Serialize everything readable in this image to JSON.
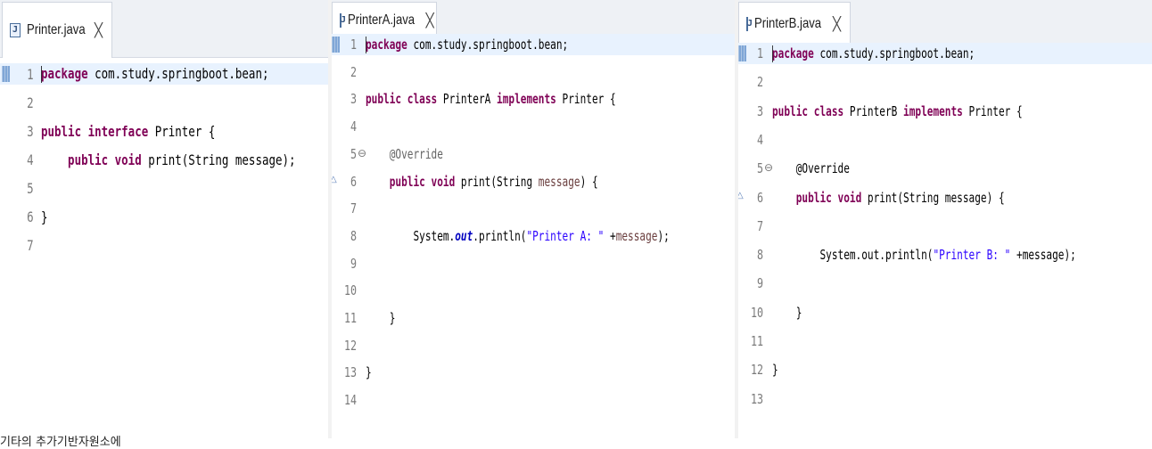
{
  "panels": [
    {
      "id": "printer",
      "tab": {
        "file_icon": "java-file-icon",
        "name": "Printer.java",
        "close": "╳"
      },
      "lines": [
        {
          "n": "1",
          "tokens": [
            {
              "t": "package",
              "c": "kw"
            },
            {
              "t": " com.study.springboot.bean;",
              "c": ""
            }
          ],
          "current": true
        },
        {
          "n": "2",
          "tokens": []
        },
        {
          "n": "3",
          "tokens": [
            {
              "t": "public",
              "c": "kw"
            },
            {
              "t": " ",
              "c": ""
            },
            {
              "t": "interface",
              "c": "kw"
            },
            {
              "t": " Printer {",
              "c": ""
            }
          ]
        },
        {
          "n": "4",
          "tokens": [
            {
              "t": "    ",
              "c": ""
            },
            {
              "t": "public",
              "c": "kw"
            },
            {
              "t": " ",
              "c": ""
            },
            {
              "t": "void",
              "c": "kw"
            },
            {
              "t": " print(String message);",
              "c": ""
            }
          ]
        },
        {
          "n": "5",
          "tokens": []
        },
        {
          "n": "6",
          "tokens": [
            {
              "t": "}",
              "c": ""
            }
          ]
        },
        {
          "n": "7",
          "tokens": []
        }
      ]
    },
    {
      "id": "printerA",
      "tab": {
        "file_icon": "java-file-icon",
        "name": "PrinterA.java",
        "close": "╳"
      },
      "lines": [
        {
          "n": "1",
          "tokens": [
            {
              "t": "package",
              "c": "kw"
            },
            {
              "t": " com.study.springboot.bean;",
              "c": ""
            }
          ],
          "current": true
        },
        {
          "n": "2",
          "tokens": []
        },
        {
          "n": "3",
          "tokens": [
            {
              "t": "public",
              "c": "kw"
            },
            {
              "t": " ",
              "c": ""
            },
            {
              "t": "class",
              "c": "kw"
            },
            {
              "t": " PrinterA ",
              "c": ""
            },
            {
              "t": "implements",
              "c": "kw"
            },
            {
              "t": " Printer {",
              "c": ""
            }
          ]
        },
        {
          "n": "4",
          "tokens": []
        },
        {
          "n": "5",
          "fold": "⊖",
          "tokens": [
            {
              "t": "    ",
              "c": ""
            },
            {
              "t": "@Override",
              "c": "ann"
            }
          ]
        },
        {
          "n": "6",
          "override": "△",
          "tokens": [
            {
              "t": "    ",
              "c": ""
            },
            {
              "t": "public",
              "c": "kw"
            },
            {
              "t": " ",
              "c": ""
            },
            {
              "t": "void",
              "c": "kw"
            },
            {
              "t": " print(String ",
              "c": ""
            },
            {
              "t": "message",
              "c": "prm"
            },
            {
              "t": ") {",
              "c": ""
            }
          ]
        },
        {
          "n": "7",
          "tokens": []
        },
        {
          "n": "8",
          "tokens": [
            {
              "t": "        System.",
              "c": ""
            },
            {
              "t": "out",
              "c": "fld"
            },
            {
              "t": ".println(",
              "c": ""
            },
            {
              "t": "\"Printer A: \"",
              "c": "str"
            },
            {
              "t": " +",
              "c": ""
            },
            {
              "t": "message",
              "c": "prm"
            },
            {
              "t": ");",
              "c": ""
            }
          ]
        },
        {
          "n": "9",
          "tokens": []
        },
        {
          "n": "10",
          "tokens": []
        },
        {
          "n": "11",
          "tokens": [
            {
              "t": "    }",
              "c": ""
            }
          ]
        },
        {
          "n": "12",
          "tokens": []
        },
        {
          "n": "13",
          "tokens": [
            {
              "t": "}",
              "c": ""
            }
          ]
        },
        {
          "n": "14",
          "tokens": []
        }
      ]
    },
    {
      "id": "printerB",
      "tab": {
        "file_icon": "java-file-icon",
        "name": "PrinterB.java",
        "close": "╳"
      },
      "lines": [
        {
          "n": "1",
          "tokens": [
            {
              "t": "package",
              "c": "kw"
            },
            {
              "t": " com.study.springboot.bean;",
              "c": ""
            }
          ],
          "current": true
        },
        {
          "n": "2",
          "tokens": []
        },
        {
          "n": "3",
          "tokens": [
            {
              "t": "public",
              "c": "kw"
            },
            {
              "t": " ",
              "c": ""
            },
            {
              "t": "class",
              "c": "kw"
            },
            {
              "t": " PrinterB ",
              "c": ""
            },
            {
              "t": "implements",
              "c": "kw"
            },
            {
              "t": " Printer {",
              "c": ""
            }
          ]
        },
        {
          "n": "4",
          "tokens": []
        },
        {
          "n": "5",
          "fold": "⊖",
          "tokens": [
            {
              "t": "    ",
              "c": ""
            },
            {
              "t": "@Override",
              "c": ""
            }
          ]
        },
        {
          "n": "6",
          "override": "△",
          "tokens": [
            {
              "t": "    ",
              "c": ""
            },
            {
              "t": "public",
              "c": "kw"
            },
            {
              "t": " ",
              "c": ""
            },
            {
              "t": "void",
              "c": "kw"
            },
            {
              "t": " print(String message) {",
              "c": ""
            }
          ]
        },
        {
          "n": "7",
          "tokens": []
        },
        {
          "n": "8",
          "tokens": [
            {
              "t": "        System.out.println(",
              "c": ""
            },
            {
              "t": "\"Printer B: \"",
              "c": "str"
            },
            {
              "t": " +message);",
              "c": ""
            }
          ]
        },
        {
          "n": "9",
          "tokens": []
        },
        {
          "n": "10",
          "tokens": [
            {
              "t": "    }",
              "c": ""
            }
          ]
        },
        {
          "n": "11",
          "tokens": []
        },
        {
          "n": "12",
          "tokens": [
            {
              "t": "}",
              "c": ""
            }
          ]
        },
        {
          "n": "13",
          "tokens": []
        }
      ]
    }
  ],
  "footer_text": "기타의 추가기반자원소에"
}
